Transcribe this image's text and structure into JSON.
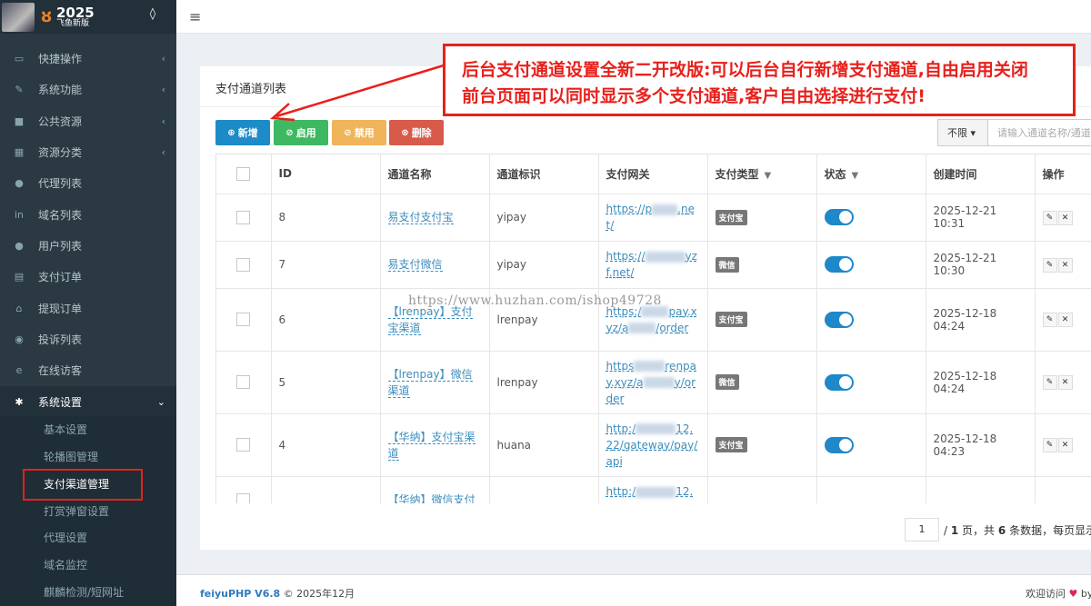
{
  "brand": {
    "year": "2025",
    "subtitle": "飞鱼新版"
  },
  "sidebar": {
    "items": [
      {
        "label": "快捷操作",
        "icon": "folder-icon",
        "arrow": "‹"
      },
      {
        "label": "系统功能",
        "icon": "wrench-icon",
        "arrow": "‹"
      },
      {
        "label": "公共资源",
        "icon": "video-icon",
        "arrow": "‹"
      },
      {
        "label": "资源分类",
        "icon": "grid-icon",
        "arrow": "‹"
      },
      {
        "label": "代理列表",
        "icon": "users-icon",
        "arrow": ""
      },
      {
        "label": "域名列表",
        "icon": "linkedin-icon",
        "arrow": ""
      },
      {
        "label": "用户列表",
        "icon": "user-icon",
        "arrow": ""
      },
      {
        "label": "支付订单",
        "icon": "database-icon",
        "arrow": ""
      },
      {
        "label": "提现订单",
        "icon": "bank-icon",
        "arrow": ""
      },
      {
        "label": "投诉列表",
        "icon": "compass-icon",
        "arrow": ""
      },
      {
        "label": "在线访客",
        "icon": "ie-icon",
        "arrow": ""
      },
      {
        "label": "系统设置",
        "icon": "gear-icon",
        "arrow": "⌄"
      }
    ],
    "submenu": [
      "基本设置",
      "轮播图管理",
      "支付渠道管理",
      "打赏弹窗设置",
      "代理设置",
      "域名监控",
      "麒麟检测/短网址"
    ]
  },
  "panel": {
    "title": "支付通道列表"
  },
  "toolbar": {
    "add": "新增",
    "enable": "启用",
    "disable": "禁用",
    "delete": "删除",
    "filter_value": "不限",
    "search_placeholder": "请输入通道名称/通道"
  },
  "table": {
    "headers": [
      "ID",
      "通道名称",
      "通道标识",
      "支付网关",
      "支付类型",
      "状态",
      "创建时间",
      "操作"
    ],
    "rows": [
      {
        "id": "8",
        "name": "易支付支付宝",
        "ident": "yipay",
        "gw": [
          "https://p",
          ".n",
          "et/"
        ],
        "type": "支付宝",
        "created": "2025-12-21 10:31"
      },
      {
        "id": "7",
        "name": "易支付微信",
        "ident": "yipay",
        "gw": [
          "https://",
          "yzf.n",
          "et/"
        ],
        "type": "微信",
        "created": "2025-12-21 10:30"
      },
      {
        "id": "6",
        "name": "【lrenpay】支付宝渠道",
        "ident": "lrenpay",
        "gw": [
          "https:/",
          "pa",
          "y.xyz/a",
          "/ord",
          "er"
        ],
        "type": "支付宝",
        "created": "2025-12-18 04:24"
      },
      {
        "id": "5",
        "name": "【lrenpay】微信渠道",
        "ident": "lrenpay",
        "gw": [
          "https",
          "renpa",
          "y.xyz/a",
          "y/ord",
          "er"
        ],
        "type": "微信",
        "created": "2025-12-18 04:24"
      },
      {
        "id": "4",
        "name": "【华纳】支付宝渠道",
        "ident": "huana",
        "gw": [
          "http:/",
          "12.2",
          "2/gateway/pay/a",
          "pi"
        ],
        "type": "支付宝",
        "created": "2025-12-18 04:23"
      },
      {
        "id": "",
        "name": "【华纳】微信支付",
        "ident": "",
        "gw": [
          "http:/",
          "12.2"
        ],
        "type": "",
        "created": ""
      }
    ]
  },
  "pagination": {
    "current": "1",
    "total_pages": "1",
    "total_records": "6",
    "text_page": "页，共",
    "text_records": "条数据，每页显示"
  },
  "footer": {
    "version": "feiyuPHP V6.8",
    "copyright": "© 2025年12月",
    "welcome": "欢迎访问",
    "by": "by"
  },
  "annotation": {
    "line1": "后台支付通道设置全新二开改版:可以后台自行新增支付通道,自由启用关闭",
    "line2": "前台页面可以同时显示多个支付通道,客户自由选择进行支付!"
  },
  "watermark": "https://www.huzhan.com/ishop49728",
  "colors": {
    "accent": "#1d8bc7",
    "success": "#3fb862",
    "warning": "#f0b45a",
    "danger": "#d75a4a",
    "annotation": "#e8201b"
  }
}
